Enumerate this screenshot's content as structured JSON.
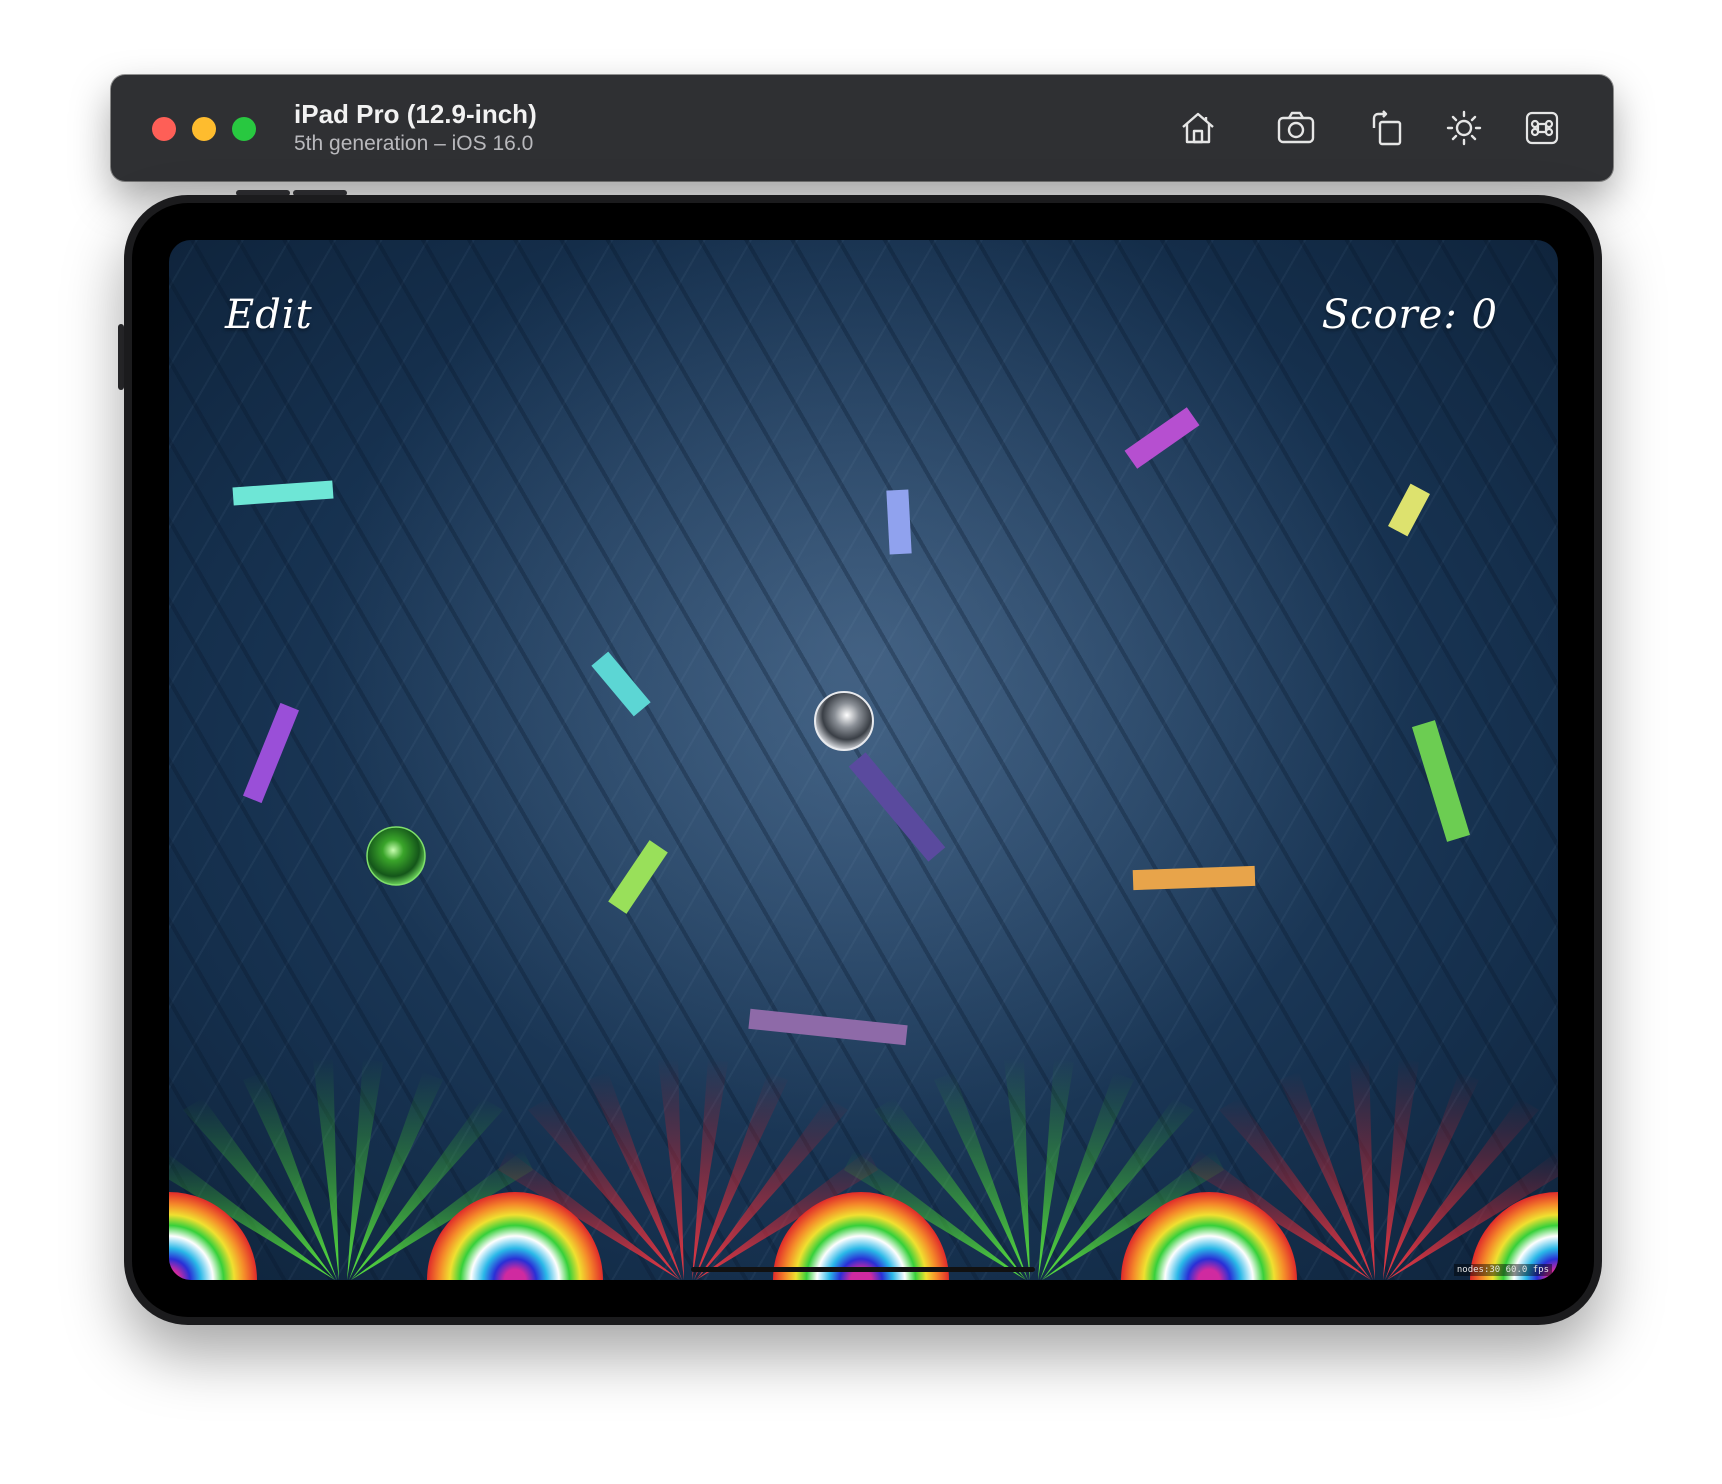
{
  "window": {
    "device_title": "iPad Pro (12.9-inch)",
    "device_subtitle": "5th generation – iOS 16.0",
    "traffic_lights": {
      "close": "#fe5f57",
      "minimize": "#febc2e",
      "zoom": "#28c840"
    },
    "toolbar_icons": [
      "home-icon",
      "screenshot-icon",
      "rotate-icon",
      "appearance-icon",
      "command-icon"
    ]
  },
  "game": {
    "edit_label": "Edit",
    "score_text": "Score: 0",
    "stats_text": "nodes:30  60.0 fps",
    "background": "blue diamond plate",
    "ball_colors": {
      "silver": "#c8ccd2",
      "green": "#3aa52a"
    },
    "bar_colors": [
      "#6ee6d6",
      "#9a4fd8",
      "#90a2ee",
      "#b64fd0",
      "#dde26e",
      "#5cd6d4",
      "#8e5ad0",
      "#99e05a",
      "#5a4a9e",
      "#6ccd52",
      "#e8a44a",
      "#8e6aa8"
    ],
    "bottom_decor_colors": [
      "#3fd03a",
      "#e33a48",
      "rainbow"
    ]
  }
}
